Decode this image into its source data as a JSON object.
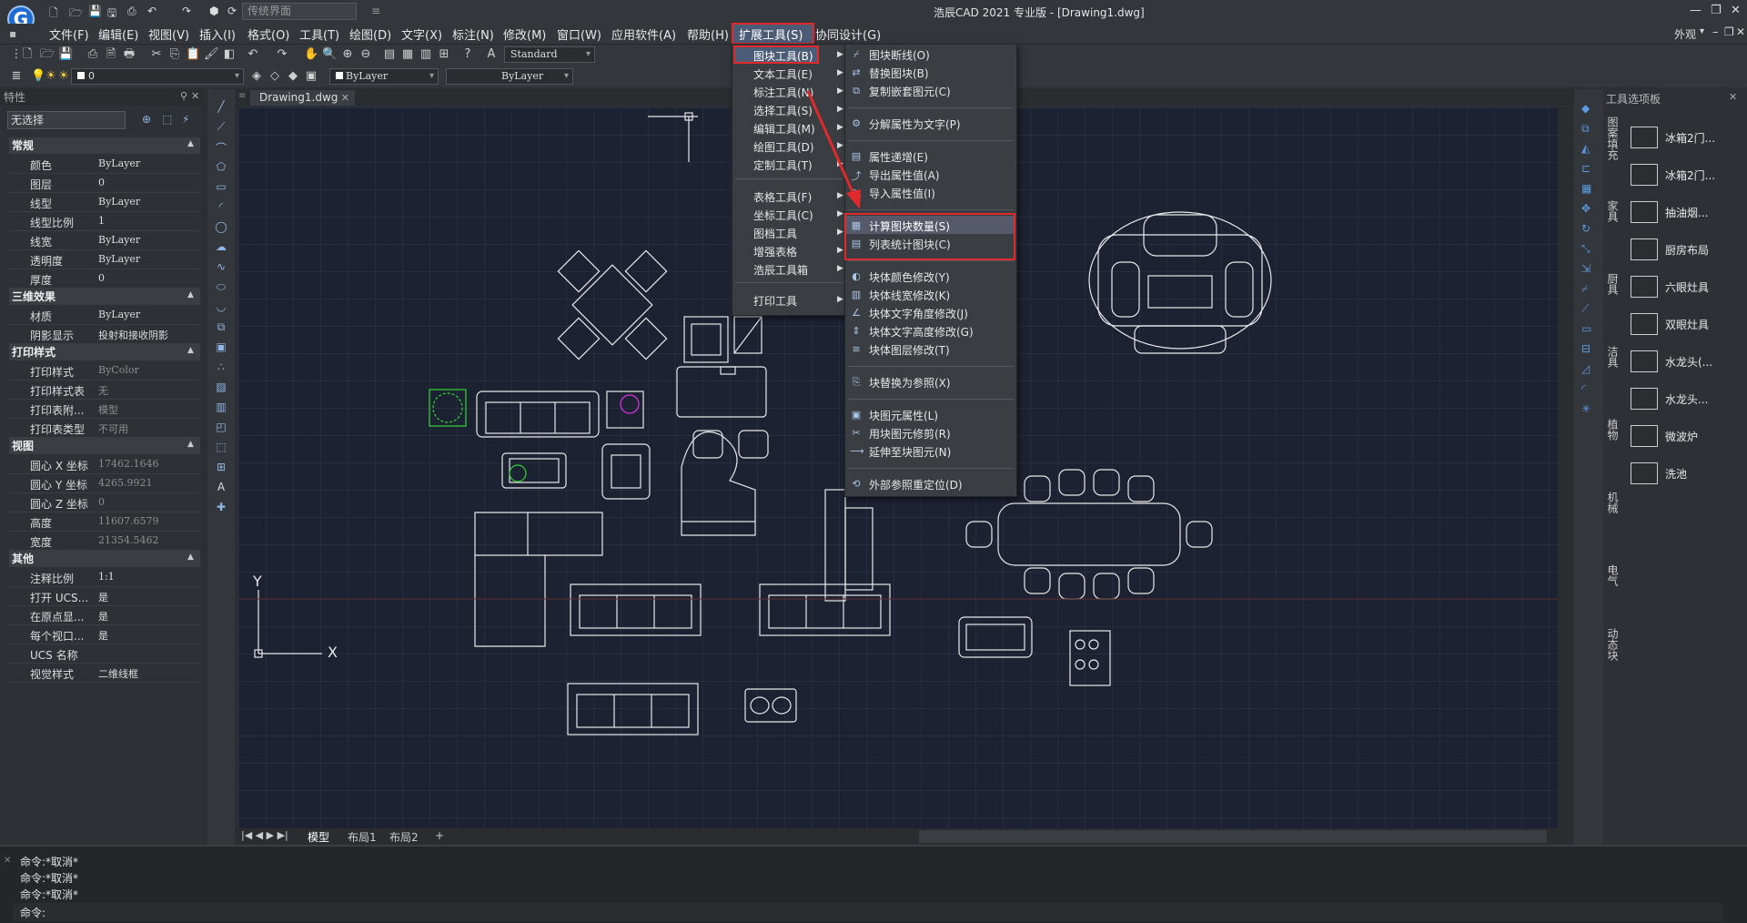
{
  "titlebar": {
    "workspace": "传统界面",
    "title": "浩辰CAD 2021 专业版 - [Drawing1.dwg]",
    "appearance": "外观"
  },
  "menubar": {
    "items": [
      "文件(F)",
      "编辑(E)",
      "视图(V)",
      "插入(I)",
      "格式(O)",
      "工具(T)",
      "绘图(D)",
      "文字(X)",
      "标注(N)",
      "修改(M)",
      "窗口(W)",
      "应用软件(A)",
      "帮助(H)",
      "扩展工具(S)",
      "协同设计(G)"
    ]
  },
  "toolbar": {
    "text_style": "Standard",
    "dim_style": "Standard",
    "layer": "0",
    "color": "ByLayer",
    "linetype": "ByLayer"
  },
  "properties": {
    "header": "特性",
    "selection": "无选择",
    "sections": [
      {
        "title": "常规",
        "rows": [
          {
            "k": "颜色",
            "v": "ByLayer"
          },
          {
            "k": "图层",
            "v": "0"
          },
          {
            "k": "线型",
            "v": "ByLayer"
          },
          {
            "k": "线型比例",
            "v": "1"
          },
          {
            "k": "线宽",
            "v": "ByLayer"
          },
          {
            "k": "透明度",
            "v": "ByLayer"
          },
          {
            "k": "厚度",
            "v": "0"
          }
        ]
      },
      {
        "title": "三维效果",
        "rows": [
          {
            "k": "材质",
            "v": "ByLayer"
          },
          {
            "k": "阴影显示",
            "v": "投射和接收阴影"
          }
        ]
      },
      {
        "title": "打印样式",
        "rows": [
          {
            "k": "打印样式",
            "v": "ByColor"
          },
          {
            "k": "打印样式表",
            "v": "无"
          },
          {
            "k": "打印表附...",
            "v": "模型"
          },
          {
            "k": "打印表类型",
            "v": "不可用"
          }
        ]
      },
      {
        "title": "视图",
        "rows": [
          {
            "k": "圆心 X 坐标",
            "v": "17462.1646"
          },
          {
            "k": "圆心 Y 坐标",
            "v": "4265.9921"
          },
          {
            "k": "圆心 Z 坐标",
            "v": "0"
          },
          {
            "k": "高度",
            "v": "11607.6579"
          },
          {
            "k": "宽度",
            "v": "21354.5462"
          }
        ]
      },
      {
        "title": "其他",
        "rows": [
          {
            "k": "注释比例",
            "v": "1:1"
          },
          {
            "k": "打开 UCS...",
            "v": "是"
          },
          {
            "k": "在原点显...",
            "v": "是"
          },
          {
            "k": "每个视口...",
            "v": "是"
          },
          {
            "k": "UCS 名称",
            "v": ""
          },
          {
            "k": "视觉样式",
            "v": "二维线框"
          }
        ]
      }
    ]
  },
  "doc_tab": "Drawing1.dwg",
  "layouts": [
    "模型",
    "布局1",
    "布局2",
    "+"
  ],
  "ucs": {
    "y": "Y",
    "x": "X"
  },
  "command": {
    "lines": [
      "命令:*取消*",
      "命令:*取消*",
      "命令:*取消*"
    ],
    "prompt": "命令:"
  },
  "tool_palette": {
    "title": "工具选项板",
    "items": [
      "冰箱2门...",
      "冰箱2门...",
      "抽油烟...",
      "厨房布局",
      "六眼灶具",
      "双眼灶具",
      "水龙头(...",
      "水龙头...",
      "微波炉",
      "洗池"
    ],
    "tabs": [
      "图案填充",
      "家具",
      "厨具",
      "洁具",
      "植物",
      "机械",
      "电气",
      "动态块"
    ]
  },
  "ext_menu": {
    "items": [
      {
        "label": "图块工具(B)",
        "arrow": true
      },
      {
        "label": "文本工具(E)",
        "arrow": true
      },
      {
        "label": "标注工具(N)",
        "arrow": true
      },
      {
        "label": "选择工具(S)",
        "arrow": true
      },
      {
        "label": "编辑工具(M)",
        "arrow": true
      },
      {
        "label": "绘图工具(D)",
        "arrow": true
      },
      {
        "label": "定制工具(T)",
        "arrow": true
      },
      {
        "label": "表格工具(F)",
        "arrow": true
      },
      {
        "label": "坐标工具(C)",
        "arrow": true
      },
      {
        "label": "图档工具",
        "arrow": true
      },
      {
        "label": "增强表格",
        "arrow": true
      },
      {
        "label": "浩辰工具箱",
        "arrow": true
      },
      {
        "label": "打印工具",
        "arrow": true
      }
    ]
  },
  "block_menu": {
    "items": [
      "图块断线(O)",
      "替换图块(B)",
      "复制嵌套图元(C)",
      "分解属性为文字(P)",
      "属性递增(E)",
      "导出属性值(A)",
      "导入属性值(I)",
      "计算图块数量(S)",
      "列表统计图块(C)",
      "块体颜色修改(Y)",
      "块体线宽修改(K)",
      "块体文字角度修改(J)",
      "块体文字高度修改(G)",
      "块体图层修改(T)",
      "块替换为参照(X)",
      "块图元属性(L)",
      "用块图元修剪(R)",
      "延伸至块图元(N)",
      "外部参照重定位(D)"
    ]
  },
  "colors": {
    "highlight": "#e0292a",
    "canvas": "#1d2232",
    "panel": "#2d3035"
  }
}
